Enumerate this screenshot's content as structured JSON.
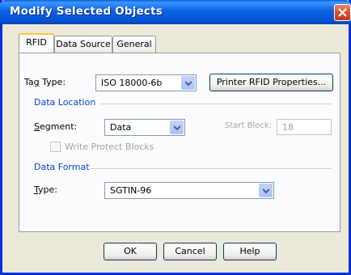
{
  "window": {
    "title": "Modify Selected Objects"
  },
  "tabs": [
    {
      "label": "RFID",
      "active": true
    },
    {
      "label": "Data Source",
      "active": false
    },
    {
      "label": "General",
      "active": false
    }
  ],
  "rfid": {
    "tag_type_label": "Tag Type:",
    "tag_type_value": "ISO 18000-6b",
    "printer_button": "Printer RFID Properties...",
    "data_location": {
      "title": "Data Location",
      "segment_label": "Segment:",
      "segment_value": "Data",
      "start_block_label": "Start Block:",
      "start_block_value": "18",
      "write_protect_label": "Write Protect Blocks",
      "write_protect_checked": false
    },
    "data_format": {
      "title": "Data Format",
      "type_label": "Type:",
      "type_value": "SGTIN-96"
    }
  },
  "buttons": {
    "ok": "OK",
    "cancel": "Cancel",
    "help": "Help"
  },
  "colors": {
    "title_bar": "#0a62e3",
    "group_title": "#0046d5",
    "dialog_bg": "#ece9d8"
  }
}
